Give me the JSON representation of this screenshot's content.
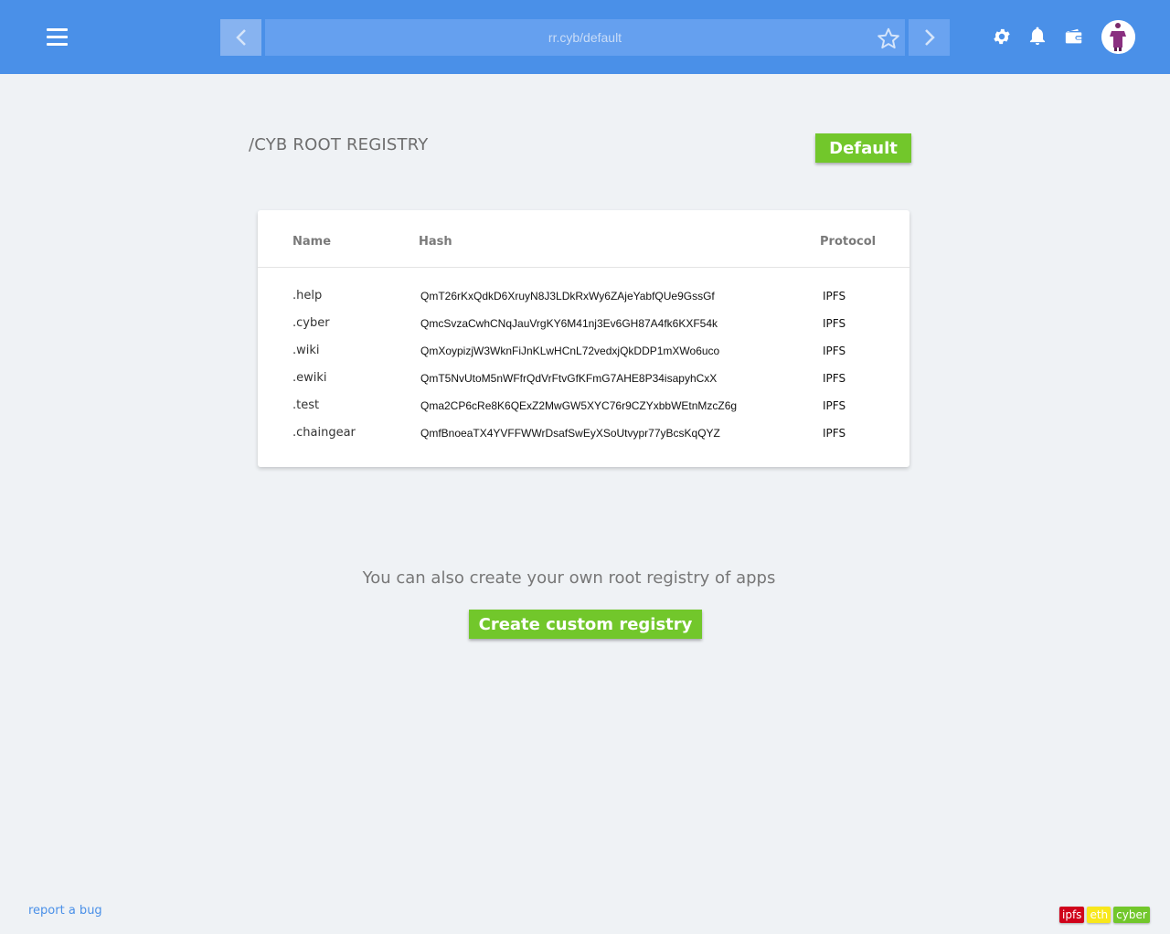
{
  "topbar": {
    "address": "rr.cyb/default",
    "colors": {
      "bar": "#4a90e8",
      "address_bg": "#65a0ef"
    },
    "icons": [
      "menu-icon",
      "chevron-left-icon",
      "star-icon",
      "chevron-right-icon",
      "gear-icon",
      "bell-icon",
      "wallet-icon"
    ]
  },
  "header": {
    "title": "/CYB ROOT REGISTRY",
    "default_button": "Default"
  },
  "table": {
    "columns": [
      "Name",
      "Hash",
      "Protocol"
    ],
    "rows": [
      {
        "name": ".help",
        "hash": "QmT26rKxQdkD6XruyN8J3LDkRxWy6ZAjeYabfQUe9GssGf",
        "protocol": "IPFS"
      },
      {
        "name": ".cyber",
        "hash": "QmcSvzaCwhCNqJauVrgKY6M41nj3Ev6GH87A4fk6KXF54k",
        "protocol": "IPFS"
      },
      {
        "name": ".wiki",
        "hash": "QmXoypizjW3WknFiJnKLwHCnL72vedxjQkDDP1mXWo6uco",
        "protocol": "IPFS"
      },
      {
        "name": ".ewiki",
        "hash": "QmT5NvUtoM5nWFfrQdVrFtvGfKFmG7AHE8P34isapyhCxX",
        "protocol": "IPFS"
      },
      {
        "name": ".test",
        "hash": "Qma2CP6cRe8K6QExZ2MwGW5XYC76r9CZYxbbWEtnMzcZ6g",
        "protocol": "IPFS"
      },
      {
        "name": ".chaingear",
        "hash": "QmfBnoeaTX4YVFFWWrDsafSwEyXSoUtvypr77yBcsKqQYZ",
        "protocol": "IPFS"
      }
    ]
  },
  "custom": {
    "text": "You can also create your own root registry of apps",
    "button": "Create custom registry"
  },
  "footer": {
    "report_link": "report a bug",
    "badges": [
      {
        "label": "ipfs",
        "color": "#d0021b"
      },
      {
        "label": "eth",
        "color": "#f8e71c"
      },
      {
        "label": "cyber",
        "color": "#72c72b"
      }
    ]
  },
  "colors": {
    "accent_green": "#72c72b",
    "background": "#eff2f5"
  }
}
